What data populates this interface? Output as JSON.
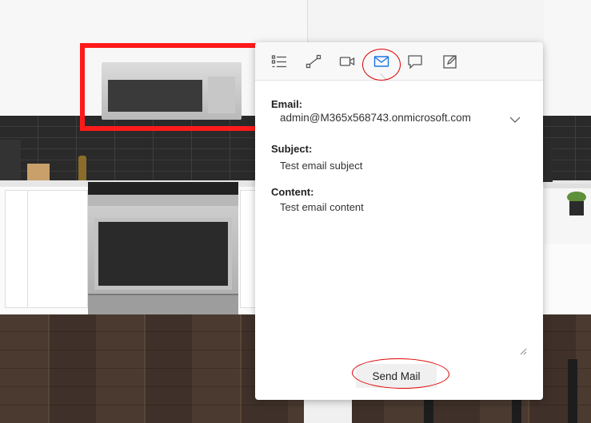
{
  "toolbar": {
    "items": [
      {
        "icon": "list-icon",
        "label": ""
      },
      {
        "icon": "connect-icon",
        "label": ""
      },
      {
        "icon": "video-icon",
        "label": ""
      },
      {
        "icon": "mail-icon",
        "label": "",
        "active": true
      },
      {
        "icon": "chat-icon",
        "label": ""
      },
      {
        "icon": "edit-icon",
        "label": ""
      }
    ]
  },
  "form": {
    "email_label": "Email:",
    "email_value": "admin@M365x568743.onmicrosoft.com",
    "subject_label": "Subject:",
    "subject_value": "Test email subject",
    "content_label": "Content:",
    "content_value": "Test email content",
    "send_label": "Send Mail"
  },
  "colors": {
    "accent": "#1a73e8",
    "annotation": "#e00000",
    "highlight_box": "#ff1a1a"
  }
}
